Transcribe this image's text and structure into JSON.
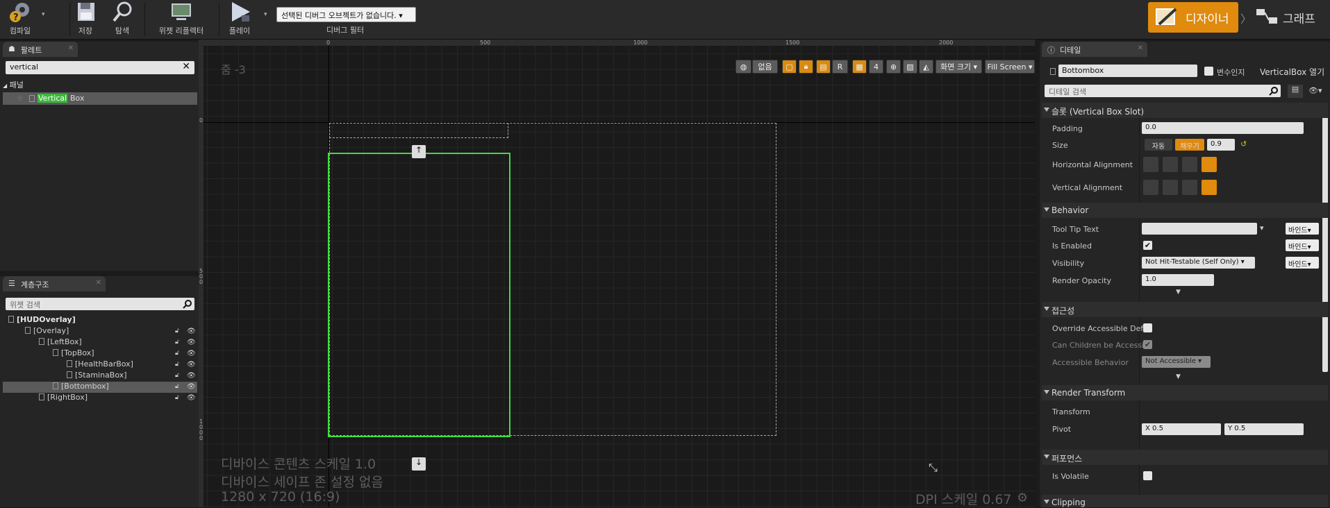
{
  "toolbar": {
    "compile": "컴파일",
    "save": "저장",
    "browse": "탐색",
    "widget_reflector": "위젯 리플렉터",
    "play": "플레이",
    "debug_select": "선택된 디버그 오브젝트가 없습니다.",
    "debug_filter": "디버그 필터",
    "designer": "디자이너",
    "graph": "그래프"
  },
  "palette": {
    "tab": "팔레트",
    "search_value": "vertical",
    "category": "패널",
    "item_highlight": "Vertical",
    "item_rest": " Box"
  },
  "hierarchy": {
    "tab": "계층구조",
    "search_placeholder": "위젯 검색",
    "items": [
      {
        "label": "[HUDOverlay]"
      },
      {
        "label": "[Overlay]"
      },
      {
        "label": "[LeftBox]"
      },
      {
        "label": "[TopBox]"
      },
      {
        "label": "[HealthBarBox]"
      },
      {
        "label": "[StaminaBox]"
      },
      {
        "label": "[Bottombox]"
      },
      {
        "label": "[RightBox]"
      }
    ]
  },
  "viewport": {
    "zoom": "줌 -3",
    "ruler_top": [
      "0",
      "500",
      "1000",
      "1500",
      "2000"
    ],
    "ruler_left": [
      "0",
      "5\n0\n0",
      "1\n0\n0\n0"
    ],
    "none_btn": "없음",
    "r_btn": "R",
    "grid_num": "4",
    "screen_size": "화면 크기",
    "fill_screen": "Fill Screen",
    "content_scale": "디바이스 콘텐츠 스케일 1.0",
    "safe_zone": "디바이스 세이프 존 설정 없음",
    "resolution": "1280 x 720 (16:9)",
    "dpi": "DPI 스케일 0.67"
  },
  "details": {
    "tab": "디테일",
    "name_value": "Bottombox",
    "is_variable": "변수인지",
    "open_link": "VerticalBox 열기",
    "search_placeholder": "디테일 검색",
    "slot_section": "슬롯 (Vertical Box Slot)",
    "padding_label": "Padding",
    "padding_value": "0.0",
    "size_label": "Size",
    "size_auto": "자동",
    "size_fill": "채우기",
    "size_value": "0.9",
    "halign_label": "Horizontal Alignment",
    "valign_label": "Vertical Alignment",
    "behavior_section": "Behavior",
    "tooltip_label": "Tool Tip Text",
    "bind": "바인드",
    "enabled_label": "Is Enabled",
    "visibility_label": "Visibility",
    "visibility_value": "Not Hit-Testable (Self Only)",
    "opacity_label": "Render Opacity",
    "opacity_value": "1.0",
    "access_section": "접근성",
    "override_label": "Override Accessible Defa",
    "children_label": "Can Children be Accessi",
    "acc_behavior_label": "Accessible Behavior",
    "acc_behavior_value": "Not Accessible",
    "render_section": "Render Transform",
    "transform_label": "Transform",
    "pivot_label": "Pivot",
    "pivot_x": "X  0.5",
    "pivot_y": "Y  0.5",
    "perf_section": "퍼포먼스",
    "volatile_label": "Is Volatile",
    "clipping_section": "Clipping"
  },
  "colors": {
    "accent": "#e08a0e",
    "selection_green": "#3fdc3f"
  }
}
